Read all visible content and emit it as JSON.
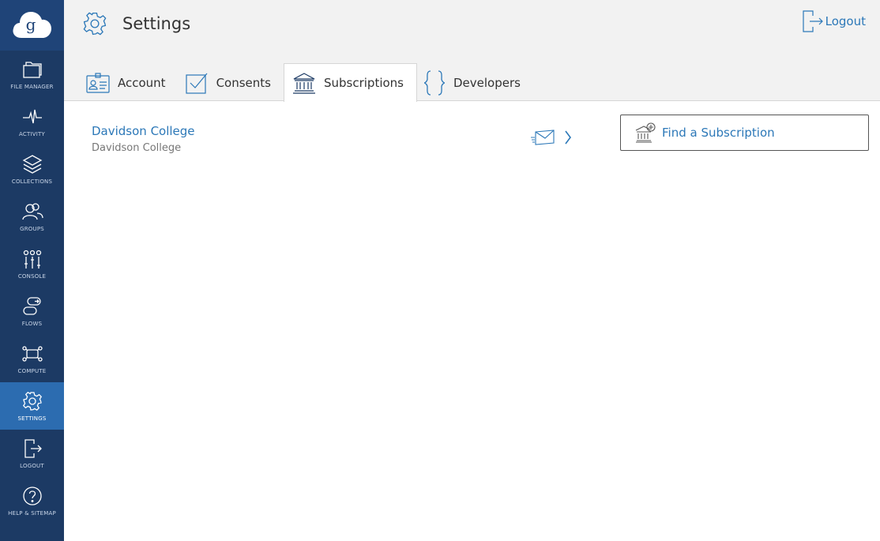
{
  "sidebar": {
    "items": [
      {
        "label": "FILE MANAGER",
        "icon": "folders-icon"
      },
      {
        "label": "ACTIVITY",
        "icon": "activity-icon"
      },
      {
        "label": "COLLECTIONS",
        "icon": "layers-icon"
      },
      {
        "label": "GROUPS",
        "icon": "groups-icon"
      },
      {
        "label": "CONSOLE",
        "icon": "sliders-icon"
      },
      {
        "label": "FLOWS",
        "icon": "flows-icon"
      },
      {
        "label": "COMPUTE",
        "icon": "compute-icon"
      },
      {
        "label": "SETTINGS",
        "icon": "gear-icon"
      },
      {
        "label": "LOGOUT",
        "icon": "logout-icon"
      },
      {
        "label": "HELP & SITEMAP",
        "icon": "help-icon"
      }
    ],
    "active": "SETTINGS"
  },
  "header": {
    "title": "Settings",
    "logout_label": "Logout"
  },
  "tabs": [
    {
      "label": "Account"
    },
    {
      "label": "Consents"
    },
    {
      "label": "Subscriptions"
    },
    {
      "label": "Developers"
    }
  ],
  "active_tab": "Subscriptions",
  "subscriptions": [
    {
      "name": "Davidson College",
      "subtitle": "Davidson College"
    }
  ],
  "find_button": {
    "label": "Find a Subscription"
  },
  "colors": {
    "sidebar": "#1c3a64",
    "sidebar_active": "#2c6cb0",
    "accent": "#2c78b8"
  }
}
